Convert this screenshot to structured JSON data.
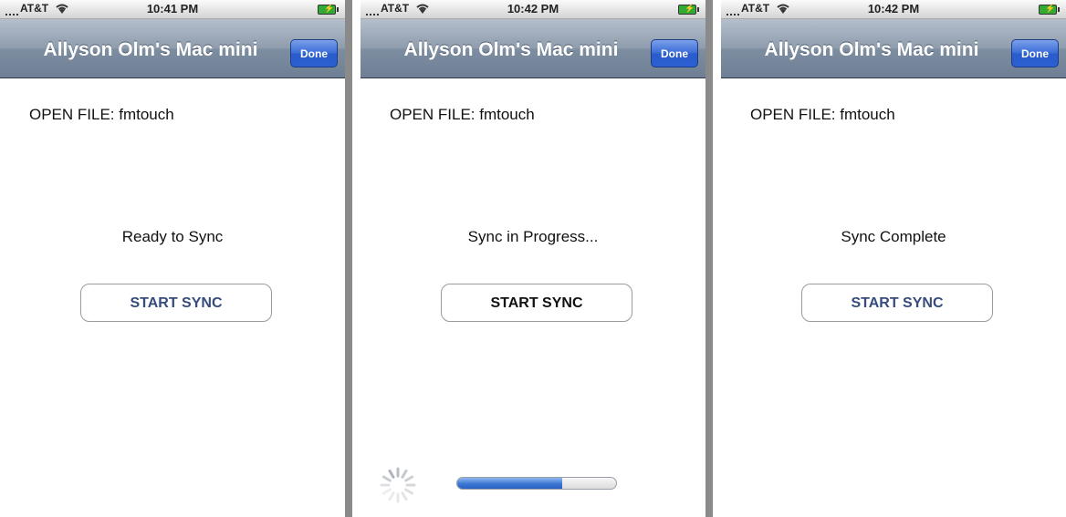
{
  "colors": {
    "nav_bar": "#7e8ea1",
    "done_button": "#2b5fd2",
    "start_button_text_idle": "#354c7c",
    "progress_fill": "#3c77d6"
  },
  "screens": [
    {
      "status": {
        "carrier": "AT&T",
        "time": "10:41 PM"
      },
      "nav": {
        "title": "Allyson Olm's Mac mini",
        "done": "Done"
      },
      "open_file": "OPEN FILE: fmtouch",
      "sync_status": "Ready to Sync",
      "start_button": "START SYNC"
    },
    {
      "status": {
        "carrier": "AT&T",
        "time": "10:42 PM"
      },
      "nav": {
        "title": "Allyson Olm's Mac mini",
        "done": "Done"
      },
      "open_file": "OPEN FILE: fmtouch",
      "sync_status": "Sync in Progress...",
      "start_button": "START SYNC",
      "progress": 0.66
    },
    {
      "status": {
        "carrier": "AT&T",
        "time": "10:42 PM"
      },
      "nav": {
        "title": "Allyson Olm's Mac mini",
        "done": "Done"
      },
      "open_file": "OPEN FILE: fmtouch",
      "sync_status": "Sync Complete",
      "start_button": "START SYNC"
    }
  ]
}
